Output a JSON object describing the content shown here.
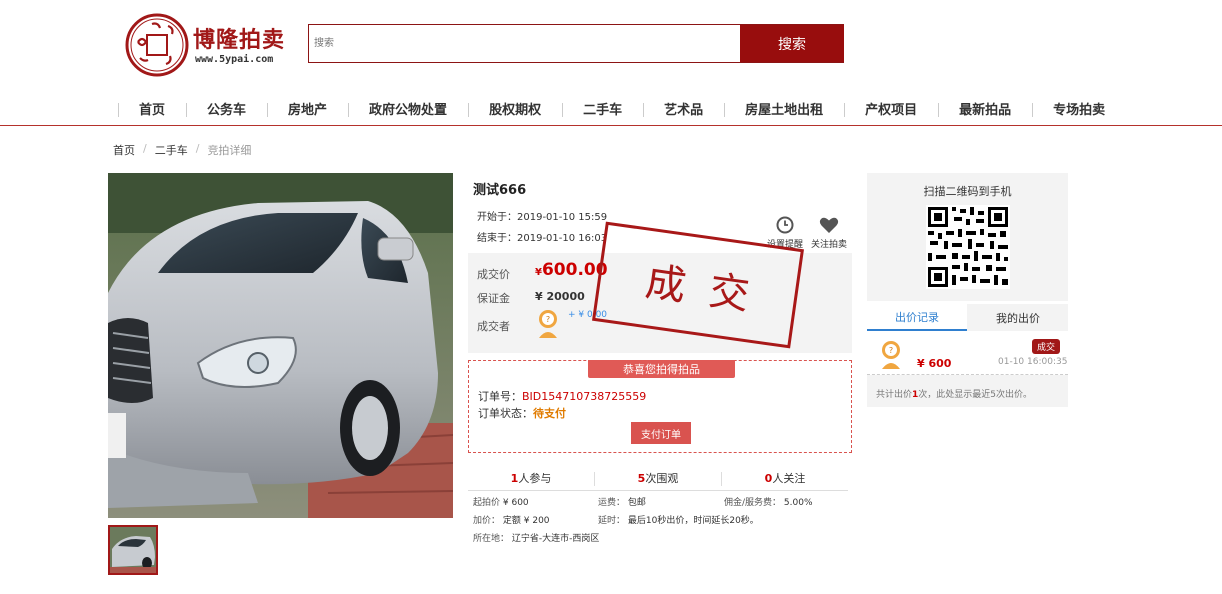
{
  "header": {
    "logo_name": "博隆拍卖",
    "logo_url": "www.5ypai.com",
    "search_placeholder": "搜索",
    "search_button": "搜索"
  },
  "nav": [
    "首页",
    "公务车",
    "房地产",
    "政府公物处置",
    "股权期权",
    "二手车",
    "艺术品",
    "房屋土地出租",
    "产权项目",
    "最新拍品",
    "专场拍卖"
  ],
  "breadcrumb": {
    "home": "首页",
    "category": "二手车",
    "current": "竞拍详细",
    "separator": "/"
  },
  "item": {
    "title": "测试666",
    "start_label": "开始于：",
    "start_time": "2019-01-10 15:59",
    "end_label": "结束于：",
    "end_time": "2019-01-10 16:03",
    "remind_label": "设置提醒",
    "follow_label": "关注拍卖"
  },
  "price_box": {
    "deal_price_label": "成交价",
    "currency": "¥",
    "deal_price": "600.00",
    "deposit_label": "保证金",
    "deposit": "¥ 20000",
    "winner_label": "成交者",
    "winner_bid": "+ ¥ 0.00",
    "stamp": "成交"
  },
  "order": {
    "congrats": "恭喜您拍得拍品",
    "order_no_label": "订单号：",
    "order_no": "BID154710738725559",
    "status_label": "订单状态：",
    "status": "待支付",
    "pay_button": "支付订单"
  },
  "stats": [
    {
      "num": "1",
      "text": "人参与"
    },
    {
      "num": "5",
      "text": "次围观"
    },
    {
      "num": "0",
      "text": "人关注"
    }
  ],
  "details": {
    "start_price_label": "起拍价",
    "start_price": "¥ 600",
    "shipping_label": "运费：",
    "shipping": "包邮",
    "commission_label": "佣金/服务费：",
    "commission": "5.00%",
    "increment_label": "加价：",
    "increment": "定额 ¥ 200",
    "delay_label": "延时：",
    "delay": "最后10秒出价，时间延长20秒。",
    "location_label": "所在地：",
    "location": "辽宁省-大连市-西岗区"
  },
  "sidebar": {
    "qr_title": "扫描二维码到手机",
    "tab_records": "出价记录",
    "tab_mine": "我的出价",
    "bid_amount": "¥ 600",
    "deal_badge": "成交",
    "bid_time": "01-10 16:00:35",
    "summary_prefix": "共计出价",
    "summary_count": "1",
    "summary_suffix": "次，此处显示最近5次出价。"
  },
  "colors": {
    "brand_red": "#980d0d",
    "price_red": "#cc0000",
    "link_blue": "#2f7fcf",
    "panel_grey": "#f3f3f3"
  }
}
